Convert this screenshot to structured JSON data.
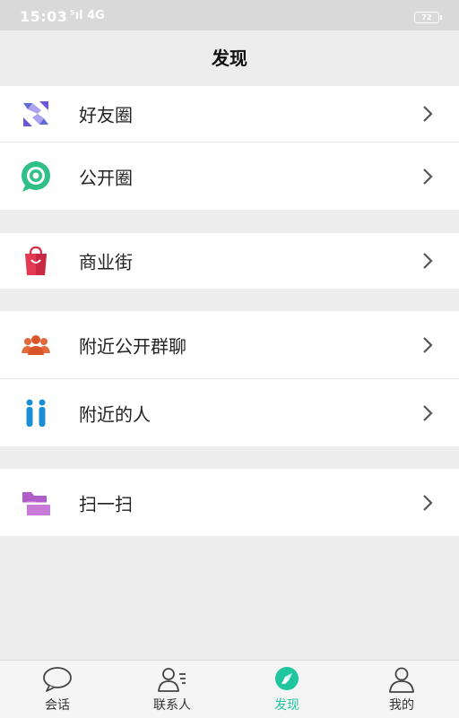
{
  "status": {
    "time": "15:03",
    "signal": "⁵ıl 4G",
    "battery": "72"
  },
  "header": {
    "title": "发现"
  },
  "menu": {
    "group1": [
      {
        "label": "好友圈",
        "icon": "friends-circle-icon"
      },
      {
        "label": "公开圈",
        "icon": "public-circle-icon"
      }
    ],
    "group2": [
      {
        "label": "商业街",
        "icon": "shopping-bag-icon"
      }
    ],
    "group3": [
      {
        "label": "附近公开群聊",
        "icon": "group-people-icon"
      },
      {
        "label": "附近的人",
        "icon": "nearby-people-icon"
      }
    ],
    "group4": [
      {
        "label": "扫一扫",
        "icon": "scan-icon"
      }
    ]
  },
  "tabs": [
    {
      "label": "会话",
      "icon": "chat-bubble-icon"
    },
    {
      "label": "联系人",
      "icon": "contacts-icon"
    },
    {
      "label": "发现",
      "icon": "compass-icon",
      "active": true
    },
    {
      "label": "我的",
      "icon": "profile-icon"
    }
  ],
  "colors": {
    "accent": "#1fc6a0",
    "background": "#ededed"
  }
}
